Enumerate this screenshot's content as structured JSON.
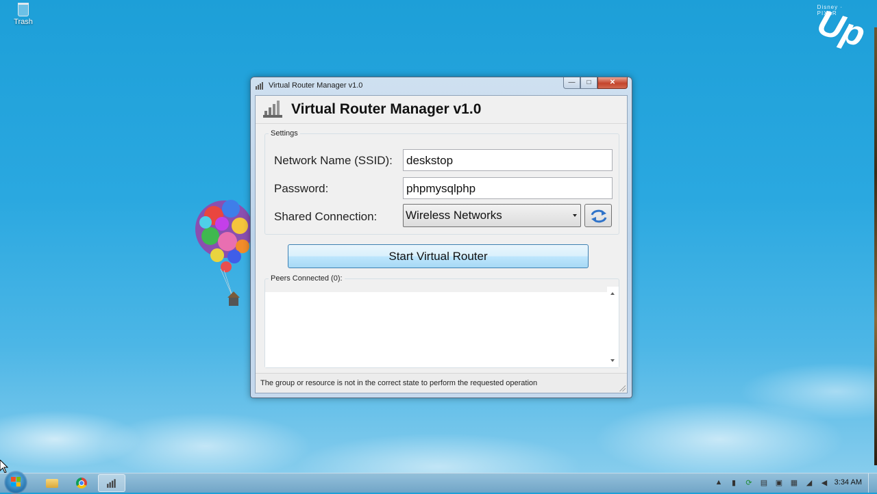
{
  "desktop": {
    "trash_label": "Trash",
    "logo_text": "Up",
    "logo_studio": "Disney · PIXAR"
  },
  "window": {
    "caption": "Virtual Router Manager v1.0",
    "minimize_glyph": "—",
    "maximize_glyph": "□",
    "close_glyph": "✕",
    "app_title": "Virtual Router Manager v1.0",
    "settings": {
      "legend": "Settings",
      "ssid_label": "Network Name (SSID):",
      "ssid_value": "deskstop",
      "password_label": "Password:",
      "password_value": "phpmysqlphp",
      "shared_label": "Shared Connection:",
      "shared_value": "Wireless Networks"
    },
    "start_button": "Start Virtual Router",
    "peers_legend": "Peers Connected (0):",
    "status": "The group or resource is not in the correct state to perform the requested operation"
  },
  "taskbar": {
    "clock": "3:34 AM",
    "tray_icons": [
      "chevron-up-icon",
      "router-icon",
      "update-icon",
      "battery-icon",
      "display-icon",
      "clipboard-icon",
      "network-icon",
      "volume-icon"
    ]
  },
  "colors": {
    "desktop_sky": "#2aa8e0",
    "close_red": "#c4452c",
    "button_blue": "#bee6fd"
  }
}
